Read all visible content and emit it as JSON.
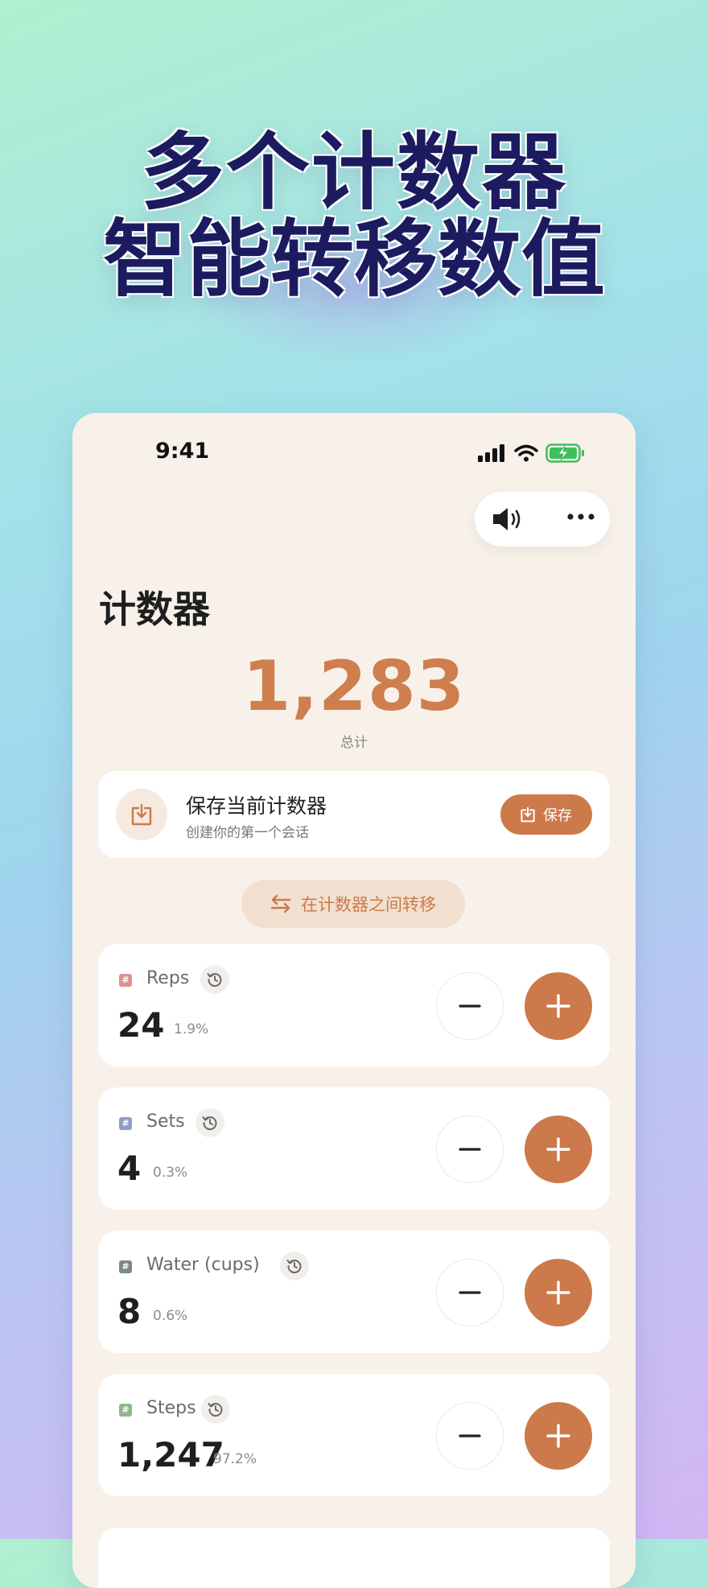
{
  "headline": {
    "line1": "多个计数器",
    "line2": "智能转移数值"
  },
  "status_bar": {
    "time": "9:41"
  },
  "toolbar": {
    "sound_icon": "speaker-icon",
    "more_icon": "ellipsis-icon"
  },
  "page": {
    "title": "计数器",
    "total_value": "1,283",
    "total_label": "总计"
  },
  "save_card": {
    "title": "保存当前计数器",
    "subtitle": "创建你的第一个会话",
    "button_label": "保存"
  },
  "transfer_button": {
    "label": "在计数器之间转移"
  },
  "counters": [
    {
      "name": "Reps",
      "value": "24",
      "percent": "1.9%",
      "tag_color": "#e08f8f"
    },
    {
      "name": "Sets",
      "value": "4",
      "percent": "0.3%",
      "tag_color": "#8e9ec4"
    },
    {
      "name": "Water (cups)",
      "value": "8",
      "percent": "0.6%",
      "tag_color": "#7c8a86"
    },
    {
      "name": "Steps",
      "value": "1,247",
      "percent": "97.2%",
      "tag_color": "#8fb88a"
    }
  ],
  "colors": {
    "accent": "#cd7a4b",
    "background": "#f7f1ea",
    "headline": "#1d1b5f"
  }
}
